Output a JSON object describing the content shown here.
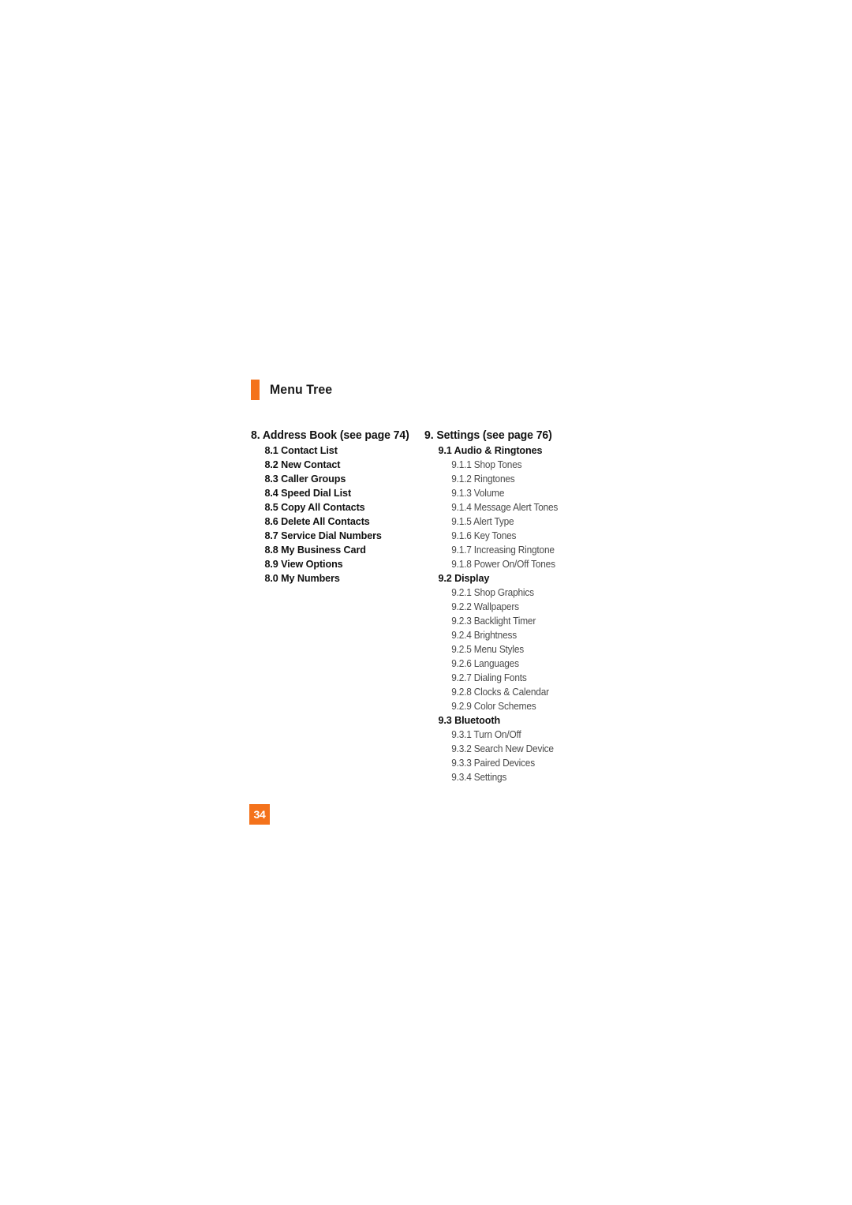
{
  "header": {
    "title": "Menu Tree",
    "marker_color": "#F4721B"
  },
  "page_badge": {
    "number": "34",
    "background_color": "#F4721B",
    "text_color": "#FFFFFF"
  },
  "columns": {
    "left": {
      "heading": "8. Address Book (see page 74)",
      "items": [
        {
          "level": 2,
          "text": "8.1 Contact List"
        },
        {
          "level": 2,
          "text": "8.2 New Contact"
        },
        {
          "level": 2,
          "text": "8.3 Caller Groups"
        },
        {
          "level": 2,
          "text": "8.4 Speed Dial List"
        },
        {
          "level": 2,
          "text": "8.5 Copy All Contacts"
        },
        {
          "level": 2,
          "text": "8.6 Delete All Contacts"
        },
        {
          "level": 2,
          "text": "8.7 Service Dial Numbers"
        },
        {
          "level": 2,
          "text": "8.8 My Business Card"
        },
        {
          "level": 2,
          "text": "8.9 View Options"
        },
        {
          "level": 2,
          "text": "8.0 My Numbers"
        }
      ]
    },
    "right": {
      "heading": "9. Settings (see page 76)",
      "items": [
        {
          "level": 2,
          "text": "9.1 Audio & Ringtones"
        },
        {
          "level": 3,
          "text": "9.1.1 Shop Tones"
        },
        {
          "level": 3,
          "text": "9.1.2 Ringtones"
        },
        {
          "level": 3,
          "text": "9.1.3 Volume"
        },
        {
          "level": 3,
          "text": "9.1.4 Message Alert Tones"
        },
        {
          "level": 3,
          "text": "9.1.5 Alert Type"
        },
        {
          "level": 3,
          "text": "9.1.6 Key Tones"
        },
        {
          "level": 3,
          "text": "9.1.7 Increasing Ringtone"
        },
        {
          "level": 3,
          "text": "9.1.8 Power On/Off Tones"
        },
        {
          "level": 2,
          "text": "9.2 Display"
        },
        {
          "level": 3,
          "text": "9.2.1 Shop Graphics"
        },
        {
          "level": 3,
          "text": "9.2.2 Wallpapers"
        },
        {
          "level": 3,
          "text": "9.2.3 Backlight Timer"
        },
        {
          "level": 3,
          "text": "9.2.4 Brightness"
        },
        {
          "level": 3,
          "text": "9.2.5 Menu Styles"
        },
        {
          "level": 3,
          "text": "9.2.6 Languages"
        },
        {
          "level": 3,
          "text": "9.2.7 Dialing Fonts"
        },
        {
          "level": 3,
          "text": "9.2.8 Clocks & Calendar"
        },
        {
          "level": 3,
          "text": "9.2.9 Color Schemes"
        },
        {
          "level": 2,
          "text": "9.3 Bluetooth"
        },
        {
          "level": 3,
          "text": "9.3.1 Turn On/Off"
        },
        {
          "level": 3,
          "text": "9.3.2 Search New Device"
        },
        {
          "level": 3,
          "text": "9.3.3 Paired Devices"
        },
        {
          "level": 3,
          "text": "9.3.4 Settings"
        }
      ]
    }
  }
}
